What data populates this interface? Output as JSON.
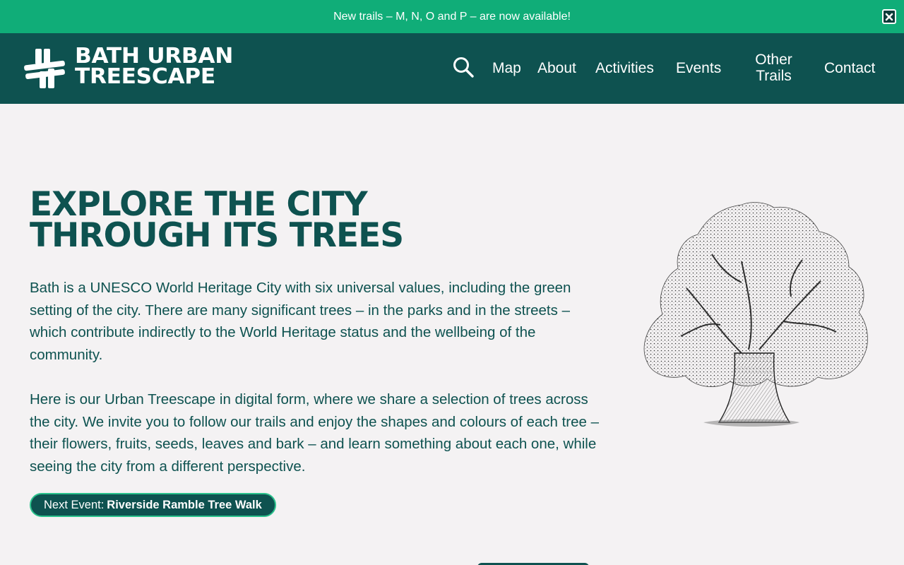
{
  "announcement": {
    "text": "New trails – M, N, O and P – are now available!",
    "close_icon": "close-x-icon"
  },
  "header": {
    "logo_line1": "BATH URBAN",
    "logo_line2": "TREESCAPE",
    "search_icon": "search-icon",
    "nav": [
      {
        "label": "Map"
      },
      {
        "label": "About"
      },
      {
        "label": "Activities"
      },
      {
        "label": "Events"
      },
      {
        "label": "Other\nTrails"
      },
      {
        "label": "Contact"
      }
    ]
  },
  "hero": {
    "title_line1": "EXPLORE THE CITY",
    "title_line2": "THROUGH ITS TREES",
    "paragraph1": "Bath is a UNESCO World Heritage City with six universal values, including the green setting of the city. There are many significant trees – in the parks and in the streets – which contribute indirectly to the World Heritage status and the wellbeing of the community.",
    "paragraph2": "Here is our Urban Treescape in digital form, where we share a selection of trees across the city. We invite you to follow our trails and enjoy the shapes and colours of each tree – their flowers, fruits, seeds, leaves and bark – and learn something about each one, while seeing the city from a different perspective.",
    "event_prefix": "Next Event:",
    "event_name": "Riverside Ramble Tree Walk"
  },
  "colors": {
    "brand_dark": "#0e5250",
    "announce_green": "#10ad78",
    "pill_border": "#2ac28c",
    "background": "#f4f2f3"
  }
}
